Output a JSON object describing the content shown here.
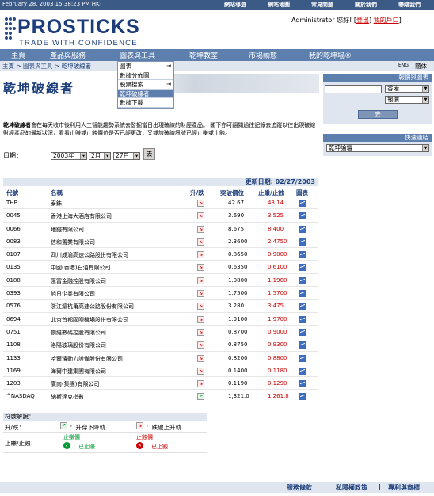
{
  "topbar": {
    "date": "February 28, 2003 15:38:23 PM HKT",
    "links": [
      "網站導遊",
      "網站地圖",
      "常見問題",
      "關於我們",
      "聯絡我們"
    ]
  },
  "logo": {
    "name": "PROSTICKS",
    "tagline": "TRADE WITH CONFIDENCE"
  },
  "account": {
    "greeting": "Administrator 您好!",
    "logout": "登出",
    "my_account": "我的戶口"
  },
  "nav": [
    "主頁",
    "產品與服務",
    "圖表與工具",
    "乾坤教室",
    "市場動態",
    "我的乾坤場®"
  ],
  "breadcrumb": "主頁 > 圖表與工具 > 乾坤破線者",
  "lang": {
    "eng": "ENG",
    "sc": "簡体"
  },
  "dropdown": [
    {
      "label": "圖表",
      "arrow": "⇥"
    },
    {
      "label": "數據分佈圖",
      "arrow": ""
    },
    {
      "label": "股票搜索",
      "arrow": "⇥"
    },
    {
      "label": "乾坤破線者",
      "arrow": ""
    },
    {
      "label": "數據下載",
      "arrow": ""
    }
  ],
  "page_title": "乾坤破線者",
  "sidebar": {
    "quote_title": "報價與圖表",
    "market": "香港",
    "quote_type": "報價",
    "go": "去",
    "quick_title": "快速連結",
    "quick_value": "乾坤論壇"
  },
  "description": {
    "bold": "乾坤破線者",
    "text": "會在每天收市後利用人工智能趨勢系統去發掘當日出現破線的財經產品。 閣下亦可翻閱過往記錄去追蹤以往出現破線財經產品的最新狀況，看看止賺或止蝕價位是否已經更改，又或該破線訊號已經止賺或止蝕。"
  },
  "date": {
    "label": "日期：",
    "year": "2003年",
    "month": "2月",
    "day": "27日",
    "go": "去"
  },
  "update": "更新日期: 02/27/2003",
  "table": {
    "headers": [
      "代號",
      "名稱",
      "升/跌",
      "突破價位",
      "止賺/止蝕",
      "圖表"
    ],
    "rows": [
      {
        "code": "THB",
        "name": "泰銖",
        "dir": "dn",
        "price": "42.67",
        "target": "43.14"
      },
      {
        "code": "0045",
        "name": "香港上海大酒店有限公司",
        "dir": "dn",
        "price": "3.690",
        "target": "3.525"
      },
      {
        "code": "0066",
        "name": "地鐵有限公司",
        "dir": "dn",
        "price": "8.675",
        "target": "8.400"
      },
      {
        "code": "0083",
        "name": "信和置業有限公司",
        "dir": "dn",
        "price": "2.3600",
        "target": "2.4750"
      },
      {
        "code": "0107",
        "name": "四川成渝高速公路股份有限公司",
        "dir": "dn",
        "price": "0.8650",
        "target": "0.9000"
      },
      {
        "code": "0135",
        "name": "中國(香港)石油有限公司",
        "dir": "dn",
        "price": "0.6350",
        "target": "0.6100"
      },
      {
        "code": "0188",
        "name": "匯富金融控股有限公司",
        "dir": "dn",
        "price": "1.0800",
        "target": "1.1900"
      },
      {
        "code": "0393",
        "name": "旭日企業有限公司",
        "dir": "dn",
        "price": "1.7500",
        "target": "1.5700"
      },
      {
        "code": "0576",
        "name": "浙江滬杭甬高速公路股份有限公司",
        "dir": "dn",
        "price": "3.280",
        "target": "3.475"
      },
      {
        "code": "0694",
        "name": "北京首都國際機場股份有限公司",
        "dir": "dn",
        "price": "1.9100",
        "target": "1.9700"
      },
      {
        "code": "0751",
        "name": "創維數碼控股有限公司",
        "dir": "dn",
        "price": "0.8700",
        "target": "0.9000"
      },
      {
        "code": "1108",
        "name": "洛陽玻璃股份有限公司",
        "dir": "dn",
        "price": "0.8750",
        "target": "0.9300"
      },
      {
        "code": "1133",
        "name": "哈爾濱動力設備股份有限公司",
        "dir": "dn",
        "price": "0.8200",
        "target": "0.8800"
      },
      {
        "code": "1169",
        "name": "海爾中建集團有限公司",
        "dir": "dn",
        "price": "0.1400",
        "target": "0.1180"
      },
      {
        "code": "1203",
        "name": "廣南(集團)有限公司",
        "dir": "dn",
        "price": "0.1190",
        "target": "0.1290"
      },
      {
        "code": "^NASDAQ",
        "name": "納斯達克指數",
        "dir": "up",
        "price": "1,321.0",
        "target": "1,261.8"
      }
    ]
  },
  "legend": {
    "title": "符號解說：",
    "dir_label": "升/跌：",
    "up_text": "：升穿下降軌",
    "dn_text": "：跌破上升軌",
    "stop_label": "止賺/止蝕：",
    "tp_title": "止賺價",
    "tp_text": "：已止賺",
    "sl_title": "止蝕價",
    "sl_text": "：已止蝕"
  },
  "footer": [
    "服務條款",
    "私隱權政策",
    "專利與商標"
  ],
  "colors": {
    "nav": "#5d7fae",
    "topbar": "#3b5a86",
    "brand": "#1c3d7a",
    "down": "#cc0000",
    "up": "#009933"
  }
}
